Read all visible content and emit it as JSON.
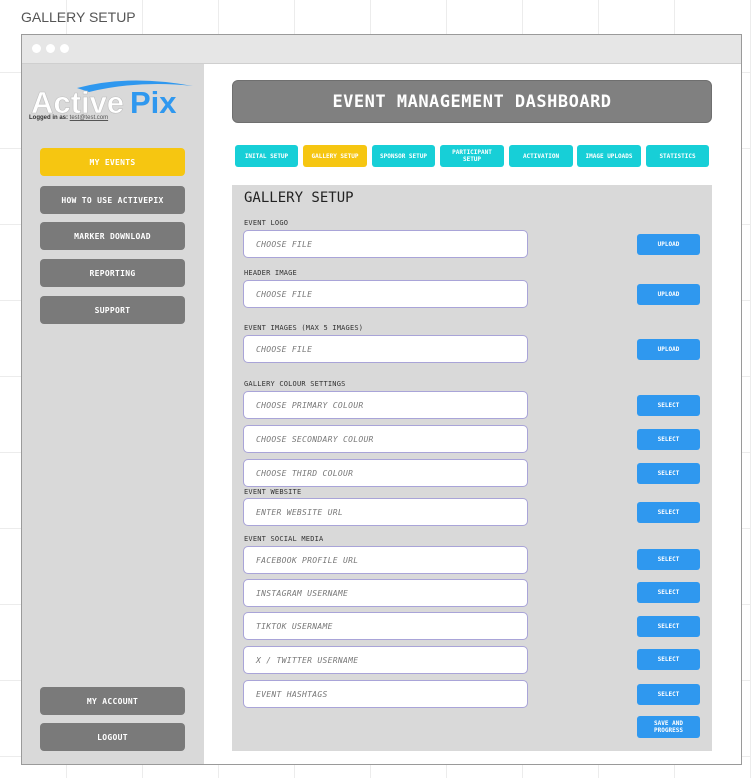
{
  "frame": {
    "title": "GALLERY SETUP"
  },
  "brand": {
    "logo_text": "ActivePix",
    "logged_in_label": "Logged in as:",
    "logged_in_user": "test@test.com"
  },
  "sidebar": {
    "items": [
      {
        "label": "MY EVENTS"
      },
      {
        "label": "HOW TO USE ACTIVEPIX"
      },
      {
        "label": "MARKER DOWNLOAD"
      },
      {
        "label": "REPORTING"
      },
      {
        "label": "SUPPORT"
      }
    ],
    "account_label": "MY ACCOUNT",
    "logout_label": "LOGOUT"
  },
  "header": {
    "title": "EVENT MANAGEMENT DASHBOARD"
  },
  "tabs": [
    {
      "label": "INITAL SETUP"
    },
    {
      "label": "GALLERY SETUP"
    },
    {
      "label": "SPONSOR SETUP"
    },
    {
      "label": "PARTICIPANT SETUP"
    },
    {
      "label": "ACTIVATION"
    },
    {
      "label": "IMAGE UPLOADS"
    },
    {
      "label": "STATISTICS"
    }
  ],
  "active_tab": "GALLERY SETUP",
  "panel": {
    "title": "GALLERY SETUP",
    "event_logo": {
      "label": "EVENT LOGO",
      "placeholder": "CHOOSE FILE",
      "button": "UPLOAD"
    },
    "header_image": {
      "label": "HEADER IMAGE",
      "placeholder": "CHOOSE FILE",
      "button": "UPLOAD"
    },
    "event_images": {
      "label": "EVENT IMAGES (MAX 5 IMAGES)",
      "placeholder": "CHOOSE FILE",
      "button": "UPLOAD"
    },
    "colour": {
      "label": "GALLERY COLOUR SETTINGS",
      "primary": {
        "placeholder": "CHOOSE PRIMARY COLOUR",
        "button": "SELECT"
      },
      "secondary": {
        "placeholder": "CHOOSE SECONDARY COLOUR",
        "button": "SELECT"
      },
      "third": {
        "placeholder": "CHOOSE THIRD COLOUR",
        "button": "SELECT"
      }
    },
    "website": {
      "label": "EVENT WEBSITE",
      "placeholder": "ENTER WEBSITE URL",
      "button": "SELECT"
    },
    "social": {
      "label": "EVENT SOCIAL MEDIA",
      "facebook": {
        "placeholder": "FACEBOOK PROFILE URL",
        "button": "SELECT"
      },
      "instagram": {
        "placeholder": "INSTAGRAM USERNAME",
        "button": "SELECT"
      },
      "tiktok": {
        "placeholder": "TIKTOK USERNAME",
        "button": "SELECT"
      },
      "twitter": {
        "placeholder": "X / TWITTER USERNAME",
        "button": "SELECT"
      },
      "hashtags": {
        "placeholder": "EVENT HASHTAGS",
        "button": "SELECT"
      }
    },
    "save_button": "SAVE AND PROGRESS"
  },
  "colors": {
    "accent_yellow": "#f6c611",
    "tab_cyan": "#17cfd7",
    "button_blue": "#2f98ef",
    "nav_gray": "#7a7a7a",
    "panel_gray": "#d9d9d9"
  }
}
